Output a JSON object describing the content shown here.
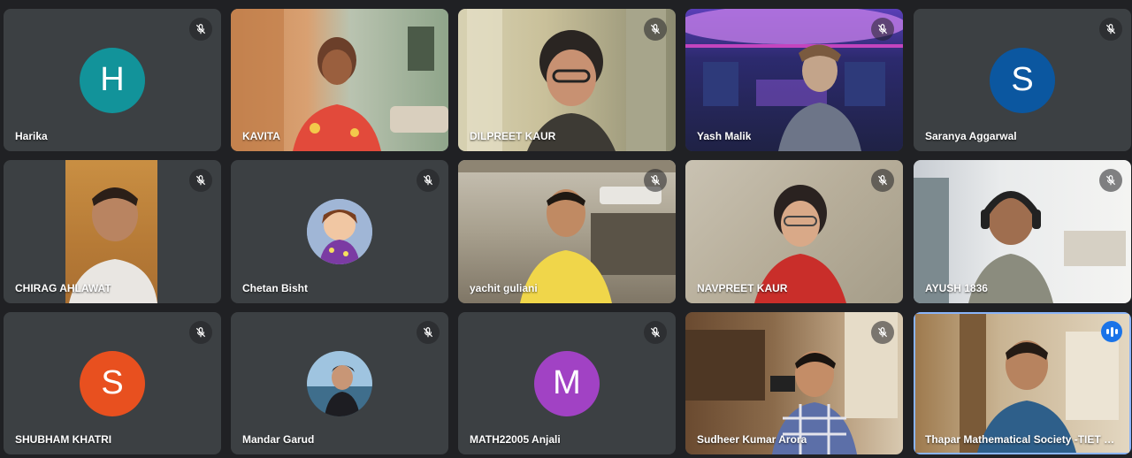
{
  "participants": [
    {
      "name": "Harika",
      "type": "initial",
      "initial": "H",
      "color": "#12939a",
      "muted": true
    },
    {
      "name": "KAVITA",
      "type": "video",
      "muted": false
    },
    {
      "name": "DILPREET KAUR",
      "type": "video",
      "muted": true
    },
    {
      "name": "Yash Malik",
      "type": "video",
      "muted": true
    },
    {
      "name": "Saranya Aggarwal",
      "type": "initial",
      "initial": "S",
      "color": "#0b57a0",
      "muted": true
    },
    {
      "name": "CHIRAG AHLAWAT",
      "type": "video",
      "muted": true
    },
    {
      "name": "Chetan Bisht",
      "type": "picture",
      "muted": true
    },
    {
      "name": "yachit guliani",
      "type": "video",
      "muted": true
    },
    {
      "name": "NAVPREET KAUR",
      "type": "video",
      "muted": true
    },
    {
      "name": "AYUSH 1836",
      "type": "video",
      "muted": true
    },
    {
      "name": "SHUBHAM KHATRI",
      "type": "initial",
      "initial": "S",
      "color": "#e8501f",
      "muted": true
    },
    {
      "name": "Mandar Garud",
      "type": "picture",
      "muted": true
    },
    {
      "name": "MATH22005 Anjali",
      "type": "initial",
      "initial": "M",
      "color": "#a142c4",
      "muted": true
    },
    {
      "name": "Sudheer Kumar Arora",
      "type": "video",
      "muted": true
    },
    {
      "name": "Thapar Mathematical Society -TIET S...",
      "type": "video",
      "muted": false,
      "speaking": true
    }
  ],
  "icons": {
    "muted": "mic-off-icon",
    "speaking": "audio-level-icon"
  }
}
